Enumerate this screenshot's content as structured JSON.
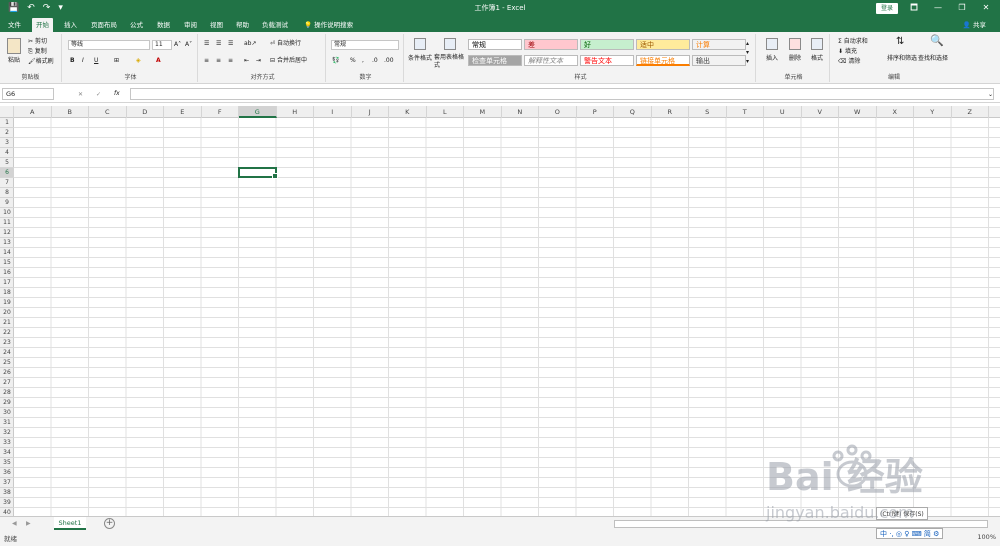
{
  "window": {
    "title": "工作簿1  -  Excel",
    "login_label": "登录",
    "controls": [
      "🗖",
      "—",
      "❐",
      "✕"
    ]
  },
  "quick_access": [
    "💾",
    "↶",
    "↷",
    "▾"
  ],
  "tabs": [
    {
      "label": "文件"
    },
    {
      "label": "开始"
    },
    {
      "label": "插入"
    },
    {
      "label": "页面布局"
    },
    {
      "label": "公式"
    },
    {
      "label": "数据"
    },
    {
      "label": "审阅"
    },
    {
      "label": "视图"
    },
    {
      "label": "帮助"
    },
    {
      "label": "负载测试"
    },
    {
      "label": "操作说明搜索"
    }
  ],
  "share_label": "共享",
  "ribbon": {
    "clipboard": {
      "paste": "粘贴",
      "cut": "剪切",
      "copy": "复制",
      "format_painter": "格式刷",
      "label": "剪贴板"
    },
    "font": {
      "font_name": "等线",
      "font_size": "11",
      "bold": "B",
      "italic": "I",
      "underline": "U",
      "label": "字体"
    },
    "alignment": {
      "wrap": "自动换行",
      "merge": "合并后居中",
      "label": "对齐方式"
    },
    "number": {
      "format": "常规",
      "percent": "%",
      "label": "数字"
    },
    "styles": {
      "conditional": "条件格式",
      "table": "套用表格格式",
      "cells": [
        {
          "text": "常规",
          "bg": "#ffffff",
          "color": "#000000"
        },
        {
          "text": "差",
          "bg": "#ffc7ce",
          "color": "#9c0006"
        },
        {
          "text": "好",
          "bg": "#c6efce",
          "color": "#006100"
        },
        {
          "text": "适中",
          "bg": "#ffeb9c",
          "color": "#9c5700"
        },
        {
          "text": "计算",
          "bg": "#f2f2f2",
          "color": "#fa7d00"
        },
        {
          "text": "检查单元格",
          "bg": "#a5a5a5",
          "color": "#ffffff"
        },
        {
          "text": "解释性文本",
          "bg": "#ffffff",
          "color": "#7f7f7f"
        },
        {
          "text": "警告文本",
          "bg": "#ffffff",
          "color": "#ff0000"
        },
        {
          "text": "链接单元格",
          "bg": "#ffffff",
          "color": "#fa7d00"
        },
        {
          "text": "输出",
          "bg": "#f2f2f2",
          "color": "#3f3f3f"
        }
      ],
      "label": "样式"
    },
    "cells_group": {
      "insert": "插入",
      "delete": "删除",
      "format": "格式",
      "label": "单元格"
    },
    "editing": {
      "autosum": "自动求和",
      "fill": "填充",
      "clear": "清除",
      "sort": "排序和筛选",
      "find": "查找和选择",
      "label": "编辑"
    }
  },
  "formula_bar": {
    "name_box": "G6",
    "fx": "fx",
    "cancel": "✕",
    "enter": "✓",
    "value": ""
  },
  "columns": [
    "A",
    "B",
    "C",
    "D",
    "E",
    "F",
    "G",
    "H",
    "I",
    "J",
    "K",
    "L",
    "M",
    "N",
    "O",
    "P",
    "Q",
    "R",
    "S",
    "T",
    "U",
    "V",
    "W",
    "X",
    "Y",
    "Z"
  ],
  "rows": [
    "1",
    "2",
    "3",
    "4",
    "5",
    "6",
    "7",
    "8",
    "9",
    "10",
    "11",
    "12",
    "13",
    "14",
    "15",
    "16",
    "17",
    "18",
    "19",
    "20",
    "21",
    "22",
    "23",
    "24",
    "25",
    "26",
    "27",
    "28",
    "29",
    "30",
    "31",
    "32",
    "33",
    "34",
    "35",
    "36",
    "37",
    "38",
    "39",
    "40"
  ],
  "active_cell": {
    "col": "G",
    "row": "6"
  },
  "sheets": [
    {
      "name": "Sheet1"
    }
  ],
  "add_sheet": "+",
  "status": {
    "ready": "就绪",
    "zoom": "100%"
  },
  "tooltip": "(Ctrl键) 保存(S)",
  "ime": "中 ·, ◎ ♀ ⌨ 简 ⚙",
  "watermark": {
    "text": "Bai 经验",
    "subtext": "jingyan.baidu.com"
  },
  "colors": {
    "accent": "#217346",
    "ribbon_bg": "#f3f3f3"
  }
}
